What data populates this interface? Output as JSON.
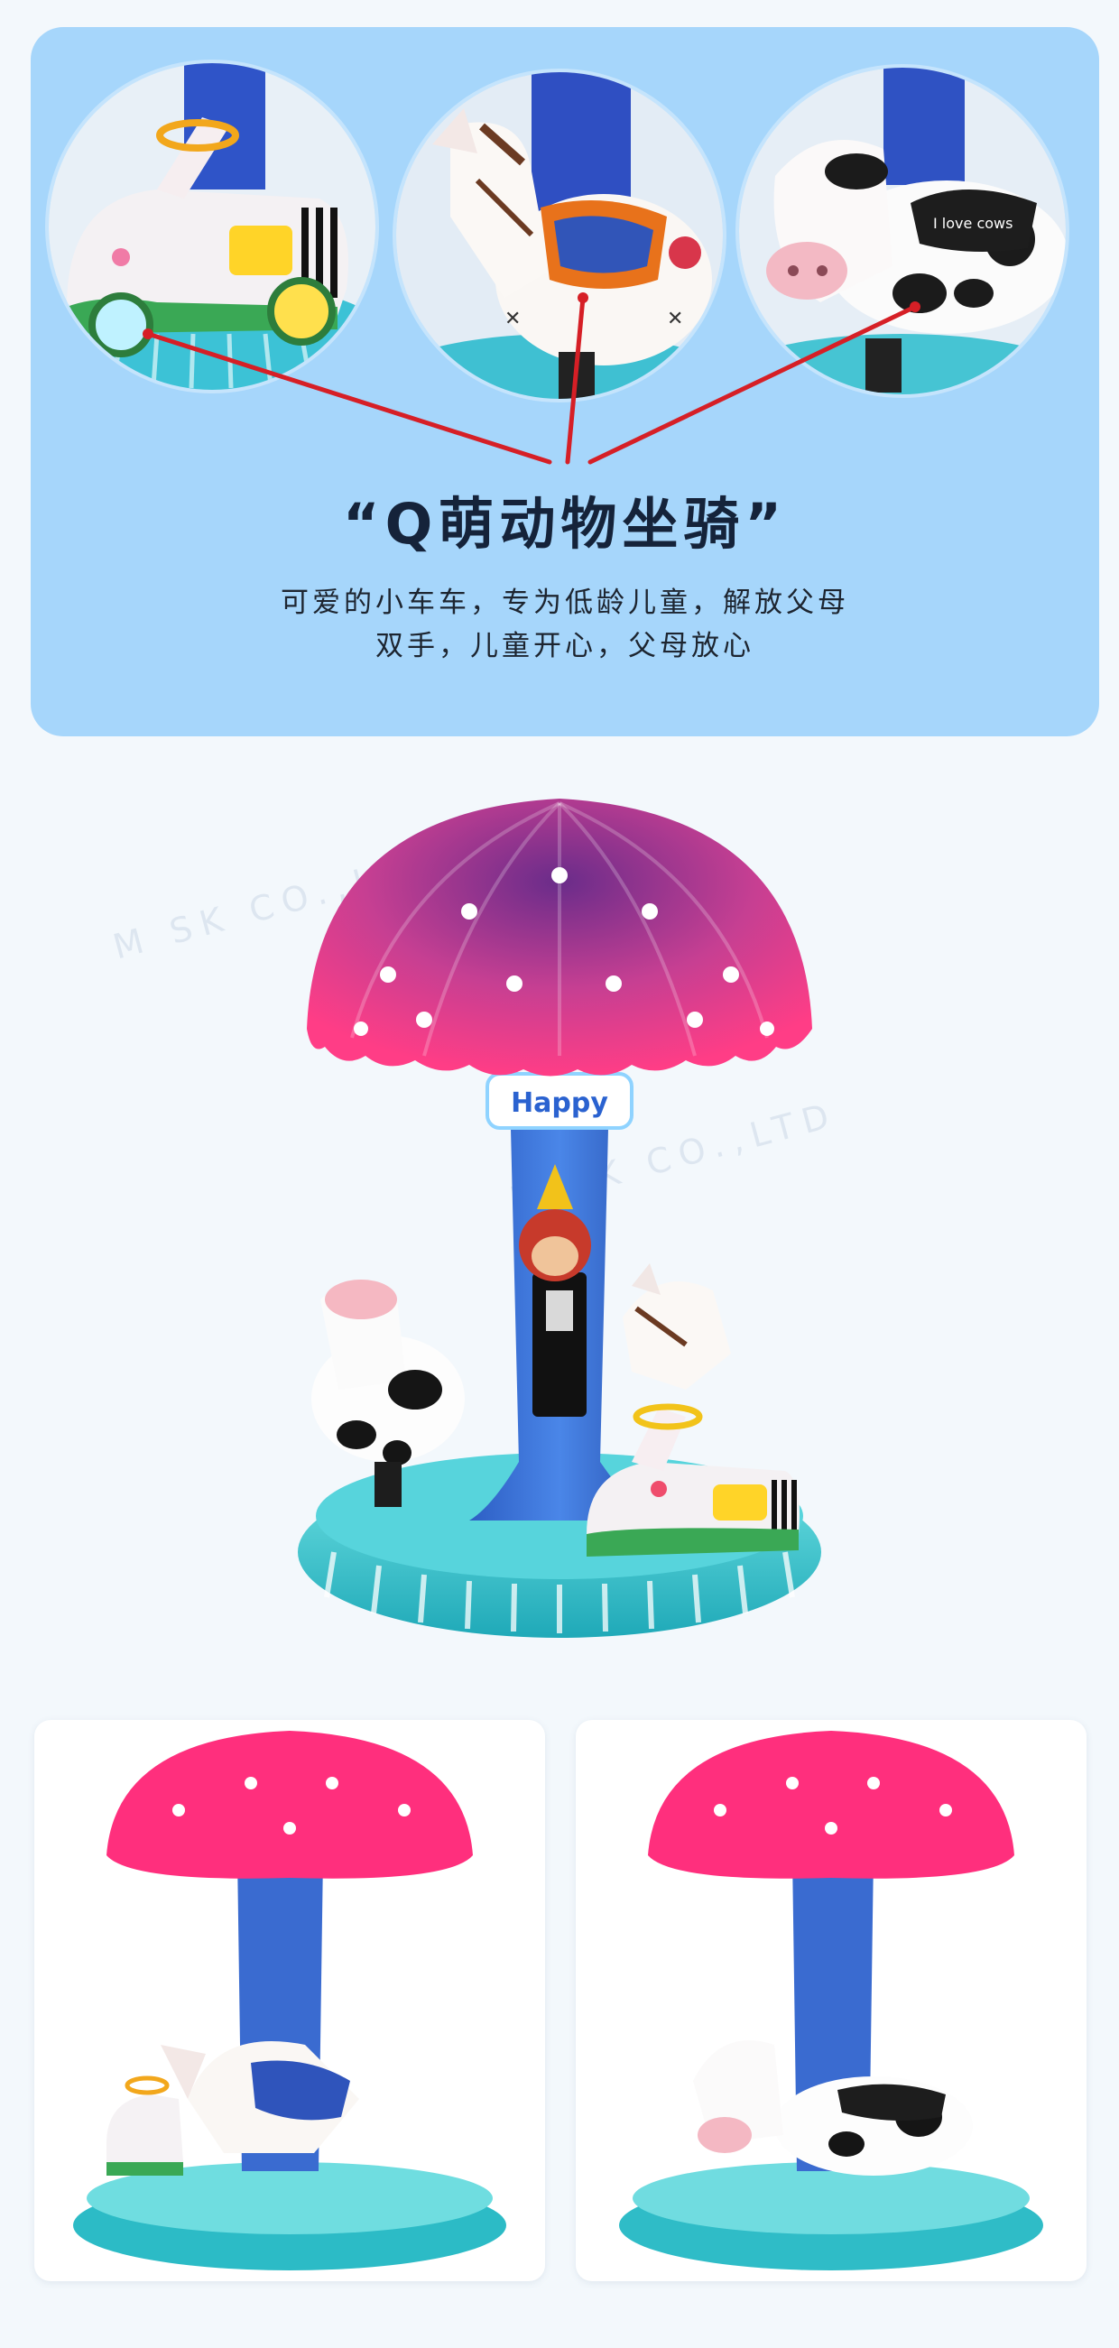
{
  "panel": {
    "headline": "“Q萌动物坐骑”",
    "description_lines": [
      "可爱的小车车，专为低龄儿童，解放父母",
      "双手，儿童开心，父母放心"
    ],
    "zoom_views": [
      "car-seat-closeup",
      "horse-seat-closeup",
      "cow-seat-closeup"
    ]
  },
  "product": {
    "sign_text": "Happy",
    "cow_saddle_text": "I love cows",
    "watermark": "M SK CO.,LTD"
  },
  "colors": {
    "panel_bg": "#a6d6fb",
    "canopy_pink": "#e8337a",
    "pillar_blue": "#3b6fd0",
    "base_teal": "#36c6cf",
    "leader_red": "#d61f26"
  }
}
